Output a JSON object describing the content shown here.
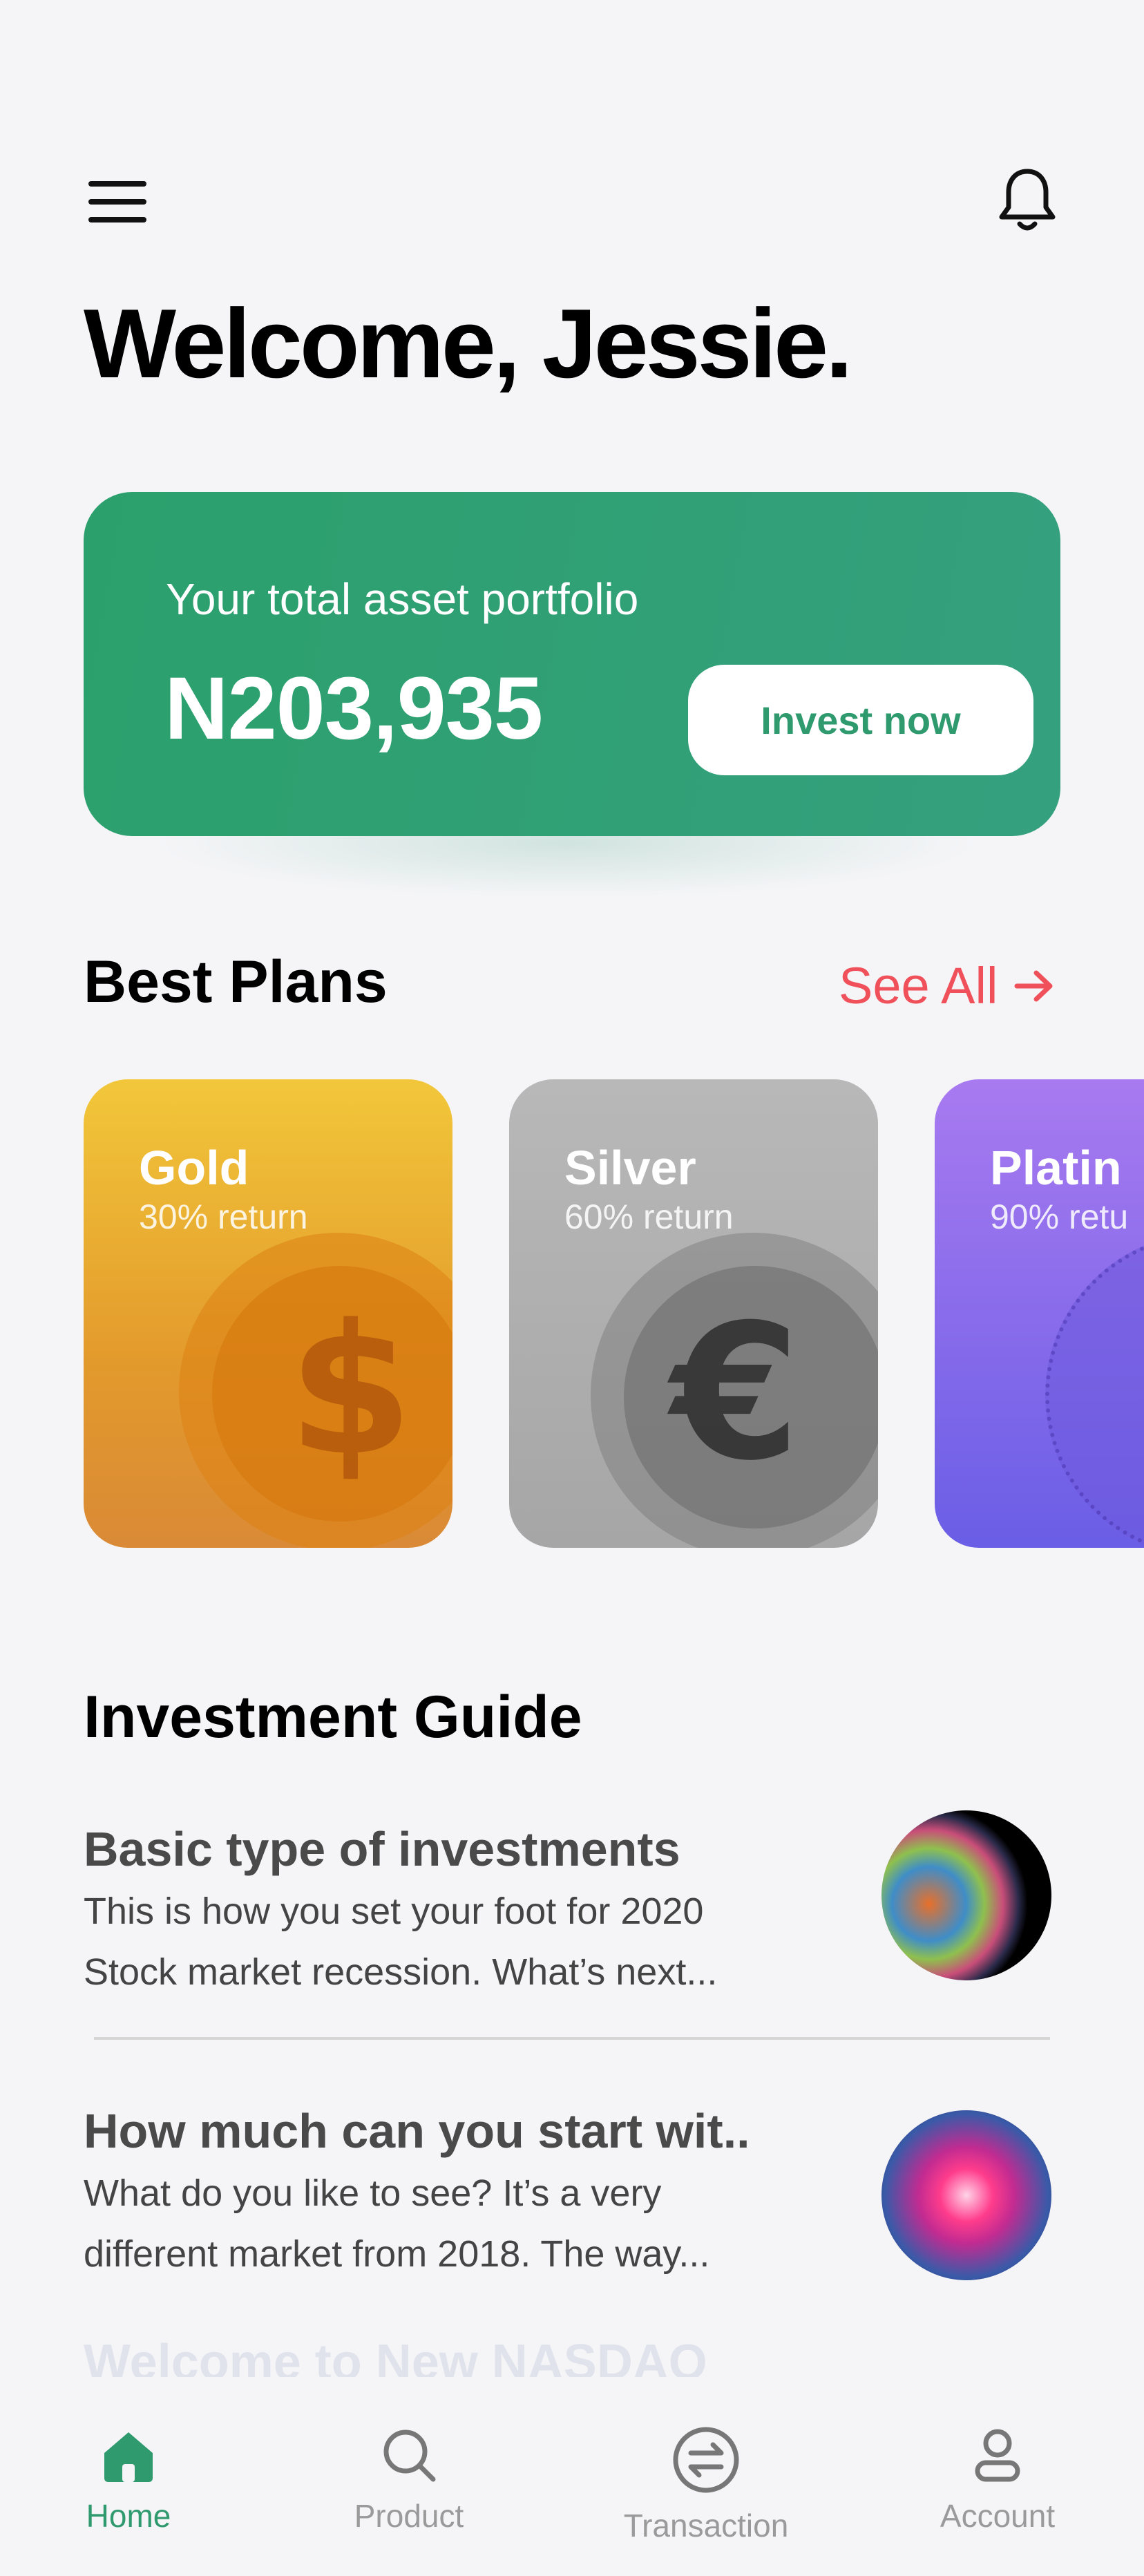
{
  "header": {
    "menu_icon": "hamburger-menu-icon",
    "notification_icon": "bell-icon",
    "greeting": "Welcome, Jessie."
  },
  "portfolio": {
    "label": "Your total asset portfolio",
    "value": "N203,935",
    "cta_label": "Invest now",
    "accent_color": "#2E9A6E"
  },
  "plans": {
    "title": "Best Plans",
    "see_all_label": "See All",
    "see_all_color": "#F0505A",
    "items": [
      {
        "name": "Gold",
        "return_label": "30% return",
        "icon": "dollar-coin-icon",
        "symbol": "$"
      },
      {
        "name": "Silver",
        "return_label": "60% return",
        "icon": "euro-coin-icon",
        "symbol": "€"
      },
      {
        "name": "Platin",
        "return_label": "90% retu",
        "icon": "crypto-coin-icon"
      }
    ]
  },
  "guide": {
    "title": "Investment Guide",
    "items": [
      {
        "title": "Basic type of investments",
        "desc_line1": "This is how you set your foot for 2020",
        "desc_line2": "Stock market recession. What’s next...",
        "thumb": "planet-thumbnail"
      },
      {
        "title": "How much can you start wit..",
        "desc_line1": "What do you like to see? It’s a very",
        "desc_line2": "different market from 2018. The way...",
        "thumb": "neon-portal-thumbnail"
      }
    ],
    "next_heading": "Welcome to New NASDAQ"
  },
  "bottom_nav": {
    "items": [
      {
        "label": "Home",
        "icon": "home-icon",
        "active": true
      },
      {
        "label": "Product",
        "icon": "search-icon",
        "active": false
      },
      {
        "label": "Transaction",
        "icon": "exchange-icon",
        "active": false
      },
      {
        "label": "Account",
        "icon": "user-icon",
        "active": false
      }
    ],
    "active_color": "#2E9A6E",
    "inactive_color": "#9A9A9A"
  }
}
